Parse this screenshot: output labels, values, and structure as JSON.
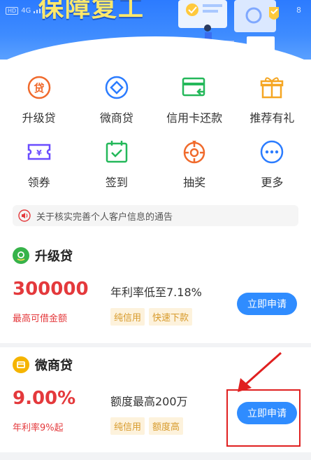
{
  "status_bar": {
    "network": "4G",
    "time": "8"
  },
  "banner": {
    "title": "保障复工"
  },
  "grid": [
    {
      "label": "升级贷",
      "icon": "loan-upgrade-icon"
    },
    {
      "label": "微商贷",
      "icon": "micro-business-loan-icon"
    },
    {
      "label": "信用卡还款",
      "icon": "credit-card-repay-icon"
    },
    {
      "label": "推荐有礼",
      "icon": "gift-icon"
    },
    {
      "label": "领券",
      "icon": "coupon-icon"
    },
    {
      "label": "签到",
      "icon": "checkin-icon"
    },
    {
      "label": "抽奖",
      "icon": "lottery-icon"
    },
    {
      "label": "更多",
      "icon": "more-icon"
    }
  ],
  "notice": {
    "text": "关于核实完善个人客户信息的通告",
    "icon": "speaker-icon"
  },
  "products": [
    {
      "name": "升级贷",
      "value": "300000",
      "sub_label": "最高可借金额",
      "desc": "年利率低至7.18%",
      "tags": [
        "纯信用",
        "快速下款"
      ],
      "button": "立即申请"
    },
    {
      "name": "微商贷",
      "value": "9.00%",
      "sub_label": "年利率9%起",
      "desc": "额度最高200万",
      "tags": [
        "纯信用",
        "额度高"
      ],
      "button": "立即申请"
    }
  ],
  "colors": {
    "accent_blue": "#2f8cff",
    "icon_orange": "#f06a2c",
    "icon_purple": "#6a4cff",
    "icon_green": "#24b85a",
    "icon_blue": "#2b7cff",
    "value_red": "#e4393c",
    "tag_bg": "#fdf2dc",
    "tag_text": "#d79a2b",
    "annotation_red": "#e02020"
  }
}
